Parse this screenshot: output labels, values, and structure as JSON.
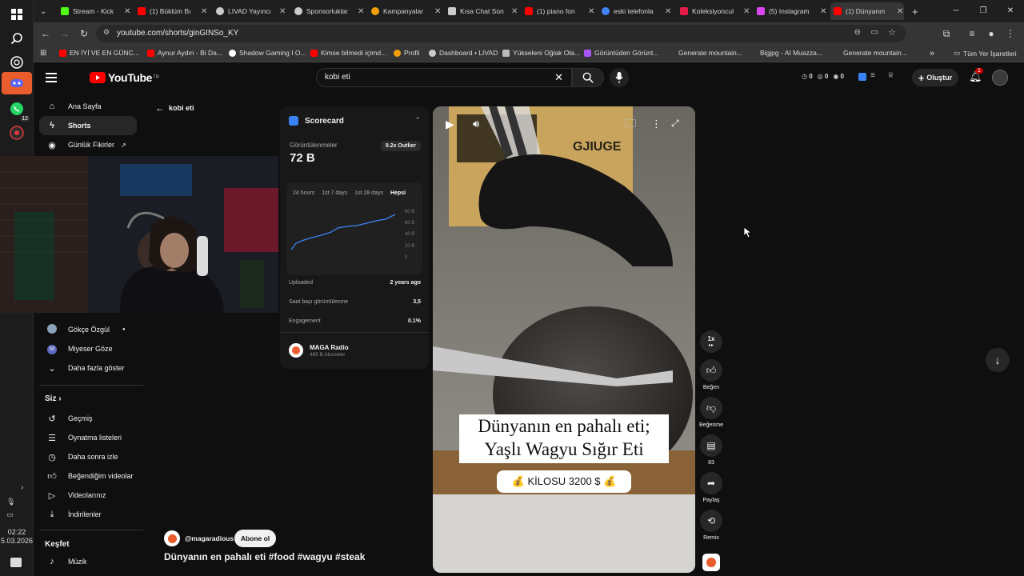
{
  "taskbar": {
    "clock_time": "02:22",
    "clock_date": "5.03.2026",
    "whatsapp_badge": "12"
  },
  "tabs": [
    {
      "label": "Stream - Kick",
      "color": "#53fc18"
    },
    {
      "label": "(1) Büklüm Bı",
      "color": "#ff0000"
    },
    {
      "label": "LIVAD Yayıncı",
      "color": "#cccccc"
    },
    {
      "label": "Sponsorluklar",
      "color": "#cccccc"
    },
    {
      "label": "Kampanyalar",
      "color": "#f59e0b"
    },
    {
      "label": "Kısa Chat Son",
      "color": "#cccccc"
    },
    {
      "label": "(1) piano fon",
      "color": "#ff0000"
    },
    {
      "label": "eski telefonla",
      "color": "#4285f4"
    },
    {
      "label": "Koleksiyoncul",
      "color": "#e11d48"
    },
    {
      "label": "(5) Instagram",
      "color": "#d946ef"
    },
    {
      "label": "(1) Dünyanın",
      "color": "#ff0000"
    }
  ],
  "omnibox": {
    "url": "youtube.com/shorts/ginGINSo_KY"
  },
  "bookmarks": [
    {
      "label": "EN İYİ VE EN GÜNC...",
      "color": "#ff0000"
    },
    {
      "label": "Aynur Aydın - Bi Da...",
      "color": "#ff0000"
    },
    {
      "label": "Shadow Gaming I O...",
      "color": "#ffffff"
    },
    {
      "label": "Kimse bilmedi içimd...",
      "color": "#ff0000"
    },
    {
      "label": "Profil",
      "color": "#f59e0b"
    },
    {
      "label": "Dashboard • LIVAD",
      "color": "#cccccc"
    },
    {
      "label": "Yükseleni Oğlak Ola...",
      "color": "#cccccc"
    },
    {
      "label": "Görüntüden Görünt...",
      "color": "#a855f7"
    },
    {
      "label": "Generate mountain...",
      "color": ""
    },
    {
      "label": "Bigjpg - AI Muazza...",
      "color": ""
    },
    {
      "label": "Generate mountain...",
      "color": ""
    }
  ],
  "bookmarks_all": "Tüm Yer İşaretleri",
  "youtube": {
    "logo_text": "YouTube",
    "logo_region": "TR",
    "search_value": "kobi eti",
    "header_counters": [
      "0",
      "0",
      "0"
    ],
    "create_label": "Oluştur",
    "notif_count": "1"
  },
  "sidebar": {
    "home": "Ana Sayfa",
    "shorts": "Shorts",
    "daily": "Günlük Fikirler",
    "sub1": "Gökçe Özgül",
    "sub2": "Miyeser Göze",
    "show_more": "Daha fazla göster",
    "you_header": "Siz",
    "history": "Geçmiş",
    "playlists": "Oynatma listeleri",
    "watch_later": "Daha sonra izle",
    "liked": "Beğendiğim videolar",
    "your_videos": "Videolarınız",
    "downloads": "İndirilenler",
    "explore_header": "Keşfet",
    "music": "Müzik"
  },
  "back_query": "kobi eti",
  "scorecard": {
    "title": "Scorecard",
    "views_label": "Görüntülenmeler",
    "views_value": "72 B",
    "outlier": "9.2x Outlier",
    "ranges": [
      "24 hours",
      "1st 7 days",
      "1st 28 days",
      "Hepsi"
    ],
    "y_ticks": [
      "80 B",
      "60 B",
      "40 B",
      "20 B",
      "0"
    ],
    "uploaded_label": "Uploaded",
    "uploaded_value": "2 years ago",
    "per_hour_label": "Saat başı görüntülenme",
    "per_hour_value": "3,5",
    "engagement_label": "Engagement",
    "engagement_value": "0.1%",
    "channel_name": "MAGA Radio",
    "channel_subs": "465 B Aboneler"
  },
  "video": {
    "caption_line1": "Dünyanın en pahalı eti;",
    "caption_line2": "Yaşlı Wagyu Sığır Eti",
    "price_text": "💰 KİLOSU 3200 $ 💰",
    "box_text": "GJIUGE",
    "channel_handle": "@magaradious",
    "subscribe_label": "Abone ol",
    "title": "Dünyanın en pahalı eti #food #wagyu #steak"
  },
  "actions": {
    "speed": "1x",
    "like": "Beğen",
    "dislike": "Beğenme",
    "comments": "83",
    "share": "Paylaş",
    "remix": "Remix"
  }
}
